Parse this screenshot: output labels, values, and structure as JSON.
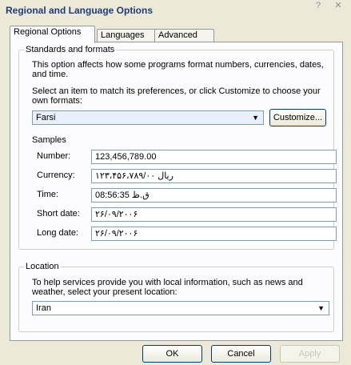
{
  "window": {
    "title": "Regional and Language Options",
    "help_label": "?",
    "close_label": "✕"
  },
  "tabs": [
    {
      "label": "Regional Options",
      "active": true
    },
    {
      "label": "Languages",
      "active": false
    },
    {
      "label": "Advanced",
      "active": false
    }
  ],
  "standards": {
    "group_label": "Standards and formats",
    "description": "This option affects how some programs format numbers, currencies, dates, and time.",
    "instruction": "Select an item to match its preferences, or click Customize to choose your own formats:",
    "selected_format": "Farsi",
    "customize_label": "Customize...",
    "samples_label": "Samples",
    "samples": [
      {
        "label": "Number:",
        "value": "123,456,789.00"
      },
      {
        "label": "Currency:",
        "value": "ريال ۱۲۳،۴۵۶،۷۸۹/۰۰"
      },
      {
        "label": "Time:",
        "value": "08:56:35 ق.ظ"
      },
      {
        "label": "Short date:",
        "value": "۲۶/۰۹/۲۰۰۶"
      },
      {
        "label": "Long date:",
        "value": "۲۶/۰۹/۲۰۰۶"
      }
    ]
  },
  "location": {
    "group_label": "Location",
    "description": "To help services provide you with local information, such as news and weather, select your present location:",
    "selected": "Iran"
  },
  "footer": {
    "ok_label": "OK",
    "cancel_label": "Cancel",
    "apply_label": "Apply"
  }
}
